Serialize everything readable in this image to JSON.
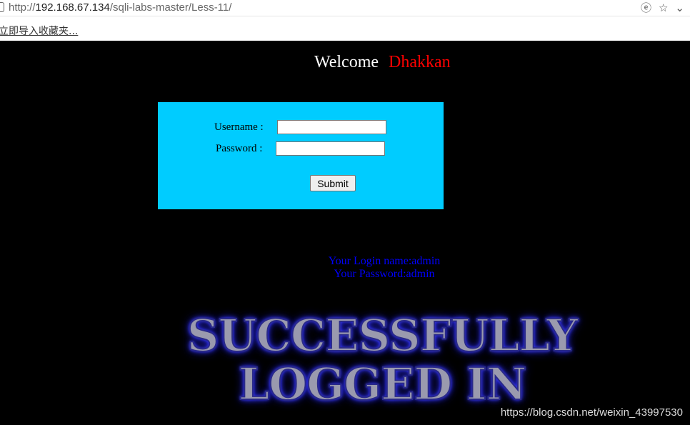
{
  "browser": {
    "url_prefix": "http://",
    "url_host": "192.168.67.134",
    "url_path": "/sqli-labs-master/Less-11/",
    "bookmarks_import_label": "立即导入收藏夹...",
    "icons": [
      "compatibility-mode-icon",
      "star-icon",
      "chevron-down-icon"
    ]
  },
  "page": {
    "welcome_text": "Welcome",
    "welcome_name": "Dhakkan",
    "form": {
      "username_label": "Username :",
      "password_label": "Password :",
      "username_value": "",
      "password_value": "",
      "submit_label": "Submit"
    },
    "result": {
      "login_name_line": "Your Login name:admin",
      "password_line": "Your Password:admin"
    },
    "success_line1": "SUCCESSFULLY",
    "success_line2": "LOGGED IN"
  },
  "watermark": "https://blog.csdn.net/weixin_43997530",
  "colors": {
    "background": "#000000",
    "form_background": "#00ccff",
    "welcome_name": "#ff0000",
    "result_text": "#0000ff"
  }
}
